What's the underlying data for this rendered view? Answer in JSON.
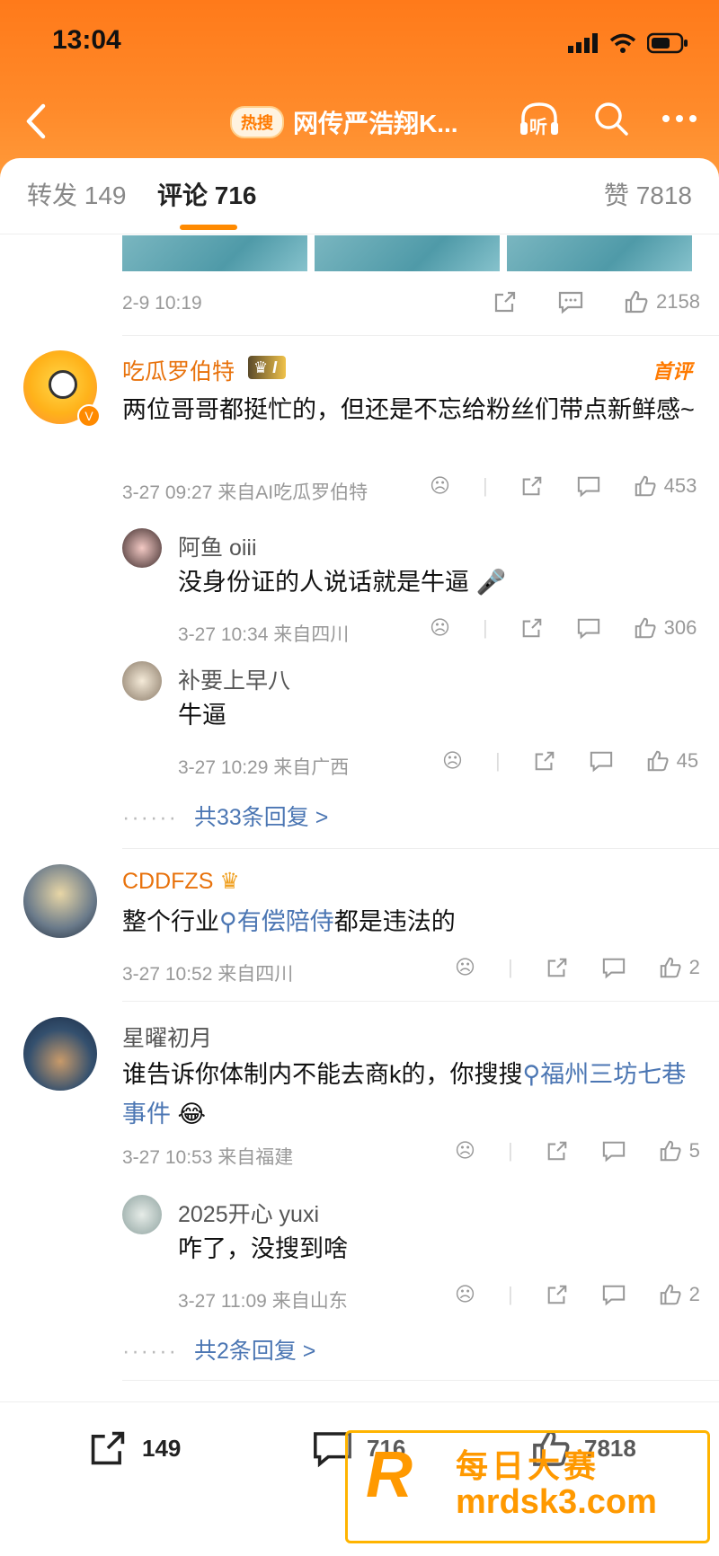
{
  "status": {
    "time": "13:04"
  },
  "nav": {
    "hot_badge": "热搜",
    "title": "网传严浩翔K...",
    "listen": "听"
  },
  "tabs": {
    "repost": "转发 149",
    "comments": "评论 716",
    "likes": "赞 7818"
  },
  "prev_post": {
    "time": "2-9 10:19",
    "likes": "2158"
  },
  "comments": [
    {
      "author": "吃瓜罗伯特",
      "level": "I",
      "pin": "首评",
      "text": "两位哥哥都挺忙的，但还是不忘给粉丝们带点新鲜感~",
      "time": "3-27 09:27 来自AI吃瓜罗伯特",
      "likes": "453",
      "replies": [
        {
          "author": "阿鱼 oiii",
          "text": "没身份证的人说话就是牛逼",
          "time": "3-27 10:34 来自四川",
          "likes": "306"
        },
        {
          "author": "补要上早八",
          "text": "牛逼",
          "time": "3-27 10:29 来自广西",
          "likes": "45"
        }
      ],
      "more": "共33条回复 >"
    },
    {
      "author": "CDDFZS",
      "text_before": "整个行业",
      "link": "有偿陪侍",
      "text_after": "都是违法的",
      "time": "3-27 10:52 来自四川",
      "likes": "2"
    },
    {
      "author": "星曜初月",
      "text_before": "谁告诉你体制内不能去商k的，你搜搜",
      "link": "福州三坊七巷事件",
      "time": "3-27 10:53 来自福建",
      "likes": "5",
      "replies": [
        {
          "author": "2025开心 yuxi",
          "text": "咋了，没搜到啥",
          "time": "3-27 11:09 来自山东",
          "likes": "2"
        }
      ],
      "more": "共2条回复 >"
    }
  ],
  "bottom": {
    "repost": "149",
    "comment": "716",
    "like": "7818"
  },
  "watermark": {
    "brand": "每日大赛",
    "url": "mrdsk3.com",
    "letter": "R"
  },
  "colors": {
    "accent": "#ff8a00",
    "link": "#4b76b3",
    "vip_name": "#e8720c"
  }
}
